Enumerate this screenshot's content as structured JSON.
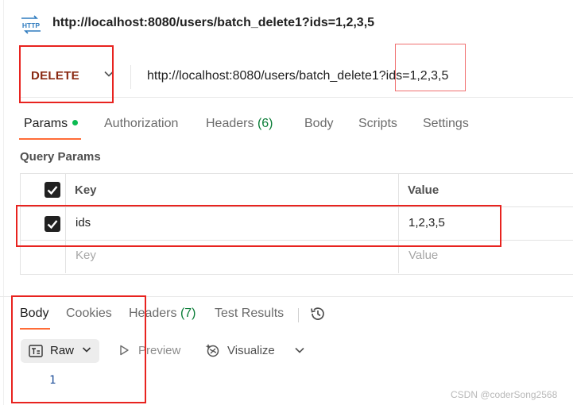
{
  "header": {
    "icon": "http-icon",
    "icon_label": "HTTP",
    "title": "http://localhost:8080/users/batch_delete1?ids=1,2,3,5"
  },
  "request": {
    "method": "DELETE",
    "method_color": "#8a2a13",
    "url": "http://localhost:8080/users/batch_delete1?ids=1,2,3,5"
  },
  "tabs": {
    "params": "Params",
    "authorization": "Authorization",
    "headers": "Headers",
    "headers_count": "(6)",
    "body": "Body",
    "scripts": "Scripts",
    "settings": "Settings"
  },
  "query_params": {
    "label": "Query Params",
    "col_key": "Key",
    "col_value": "Value",
    "rows": [
      {
        "checked": true,
        "key": "ids",
        "value": "1,2,3,5"
      }
    ],
    "placeholder_key": "Key",
    "placeholder_value": "Value"
  },
  "response": {
    "tabs": {
      "body": "Body",
      "cookies": "Cookies",
      "headers": "Headers",
      "headers_count": "(7)",
      "test_results": "Test Results"
    },
    "format": "Raw",
    "preview": "Preview",
    "visualize": "Visualize",
    "body_lines": [
      "1"
    ]
  },
  "watermark": "CSDN @coderSong2568",
  "colors": {
    "accent": "#ff6c37",
    "green": "#0cbb52",
    "annotation_red": "#e8231f"
  }
}
